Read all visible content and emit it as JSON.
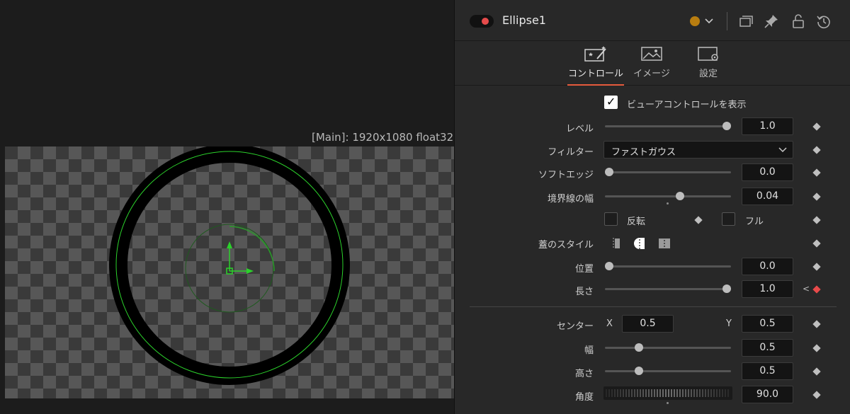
{
  "viewer": {
    "label": "[Main]: 1920x1080 float32"
  },
  "header": {
    "title": "Ellipse1",
    "color": "#b87d10"
  },
  "tabs": [
    {
      "label": "コントロール",
      "icon": "magic-wand-icon",
      "active": true
    },
    {
      "label": "イメージ",
      "icon": "image-icon",
      "active": false
    },
    {
      "label": "設定",
      "icon": "settings-icon",
      "active": false
    }
  ],
  "controls": {
    "show_view_controls": {
      "label": "ビューアコントロールを表示",
      "checked": true
    },
    "level": {
      "label": "レベル",
      "value": "1.0",
      "slider": 1.0
    },
    "filter": {
      "label": "フィルター",
      "value": "ファストガウス"
    },
    "soft_edge": {
      "label": "ソフトエッジ",
      "value": "0.0",
      "slider": 0.0
    },
    "border_width": {
      "label": "境界線の幅",
      "value": "0.04",
      "slider": 0.6
    },
    "invert": {
      "label": "反転",
      "checked": false
    },
    "full": {
      "label": "フル",
      "checked": false
    },
    "cap_style": {
      "label": "蓋のスタイル"
    },
    "position": {
      "label": "位置",
      "value": "0.0",
      "slider": 0.0
    },
    "length": {
      "label": "長さ",
      "value": "1.0",
      "slider": 1.0
    },
    "center": {
      "label": "センター",
      "x_label": "X",
      "x": "0.5",
      "y_label": "Y",
      "y": "0.5"
    },
    "width": {
      "label": "幅",
      "value": "0.5",
      "slider": 0.25
    },
    "height": {
      "label": "高さ",
      "value": "0.5",
      "slider": 0.25
    },
    "angle": {
      "label": "角度",
      "value": "90.0"
    }
  },
  "colors": {
    "accent": "#e55a3c",
    "keyframe_active": "#e84a4a",
    "ellipse_outline": "#2bd12b"
  }
}
